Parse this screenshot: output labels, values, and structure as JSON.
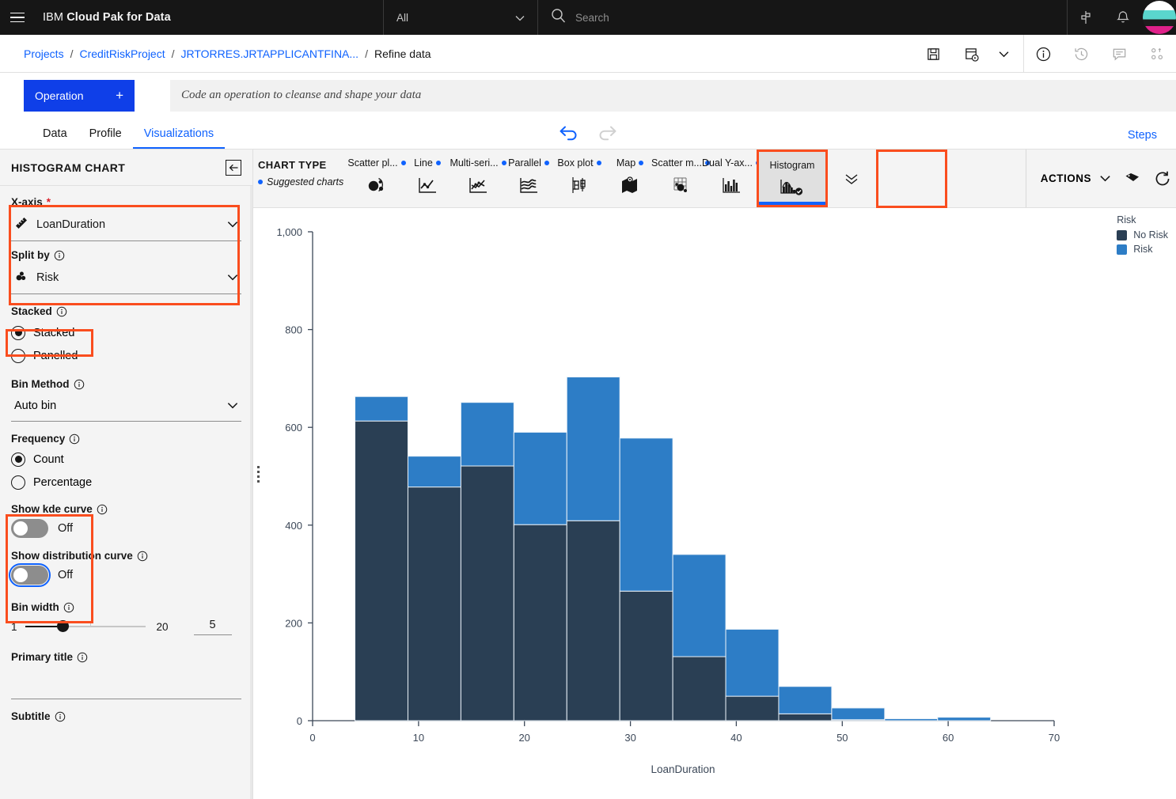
{
  "topbar": {
    "menu_icon": "hamburger-icon",
    "brand_prefix": "IBM",
    "brand_name": "Cloud Pak for Data",
    "scope_selector": "All",
    "search_placeholder": "Search",
    "icons": [
      "switcher-icon",
      "notification-bell-icon",
      "user-avatar"
    ]
  },
  "breadcrumb": {
    "items": [
      {
        "label": "Projects",
        "link": true
      },
      {
        "label": "CreditRiskProject",
        "link": true
      },
      {
        "label": "JRTORRES.JRTAPPLICANTFINA...",
        "link": true
      },
      {
        "label": "Refine data",
        "link": false
      }
    ],
    "separator": "/",
    "tools": [
      "save-icon",
      "run-icon",
      "chevron-down-icon",
      "information-icon",
      "history-icon",
      "comment-icon",
      "shortcuts-icon"
    ]
  },
  "operation": {
    "button_label": "Operation",
    "button_plus": "+",
    "code_placeholder": "Code an operation to cleanse and shape your data"
  },
  "tabs": {
    "items": [
      "Data",
      "Profile",
      "Visualizations"
    ],
    "active": "Visualizations",
    "undo_icon": "undo-icon",
    "redo_icon": "redo-icon",
    "steps_label": "Steps"
  },
  "panel": {
    "title": "HISTOGRAM CHART",
    "collapse_icon": "collapse-panel-icon",
    "x_axis": {
      "label": "X-axis",
      "required_mark": "*",
      "value": "LoanDuration",
      "icon": "measure-icon"
    },
    "split_by": {
      "label": "Split by",
      "value": "Risk",
      "icon": "category-icon"
    },
    "stacked": {
      "label": "Stacked",
      "options": [
        "Stacked",
        "Panelled"
      ],
      "selected": "Stacked"
    },
    "bin_method": {
      "label": "Bin Method",
      "value": "Auto bin"
    },
    "frequency": {
      "label": "Frequency",
      "options": [
        "Count",
        "Percentage"
      ],
      "selected": "Count"
    },
    "kde": {
      "label": "Show kde curve",
      "state": "Off"
    },
    "distribution": {
      "label": "Show distribution curve",
      "state": "Off"
    },
    "bin_width": {
      "label": "Bin width",
      "min": "1",
      "max": "20",
      "value": "5"
    },
    "primary_title": {
      "label": "Primary title",
      "value": ""
    },
    "subtitle": {
      "label": "Subtitle",
      "value": ""
    }
  },
  "chart_type_bar": {
    "heading": "CHART TYPE",
    "suggested_label": "Suggested charts",
    "items": [
      {
        "label": "Scatter pl...",
        "icon": "scatter-plot-icon",
        "suggested": true,
        "selected": false
      },
      {
        "label": "Line",
        "icon": "line-chart-icon",
        "suggested": true,
        "selected": false
      },
      {
        "label": "Multi-seri...",
        "icon": "multi-series-icon",
        "suggested": true,
        "selected": false
      },
      {
        "label": "Parallel",
        "icon": "parallel-coordinates-icon",
        "suggested": true,
        "selected": false
      },
      {
        "label": "Box plot",
        "icon": "box-plot-icon",
        "suggested": true,
        "selected": false
      },
      {
        "label": "Map",
        "icon": "map-icon",
        "suggested": true,
        "selected": false
      },
      {
        "label": "Scatter m...",
        "icon": "scatter-matrix-icon",
        "suggested": true,
        "selected": false
      },
      {
        "label": "Dual Y-ax...",
        "icon": "dual-y-axes-icon",
        "suggested": true,
        "selected": false
      },
      {
        "label": "Histogram",
        "icon": "histogram-icon",
        "suggested": false,
        "selected": true
      }
    ],
    "expand_icon": "chevron-double-down-icon",
    "actions_label": "ACTIONS",
    "actions_chevron": "chevron-down-icon",
    "tag_icon": "tag-icon",
    "reset_icon": "reset-icon"
  },
  "chart_data": {
    "type": "bar",
    "title": "",
    "subtitle": "",
    "xlabel": "LoanDuration",
    "ylabel": "",
    "xlim": [
      0,
      70
    ],
    "ylim": [
      0,
      1000
    ],
    "xticks": [
      "0",
      "10",
      "20",
      "30",
      "40",
      "50",
      "60",
      "70"
    ],
    "yticks": [
      "0",
      "200",
      "400",
      "600",
      "800",
      "1,000"
    ],
    "grid": false,
    "stacked": true,
    "bin_width": 5,
    "legend": {
      "title": "Risk",
      "position": "right",
      "entries": [
        {
          "name": "No Risk",
          "color": "#2a3f54"
        },
        {
          "name": "Risk",
          "color": "#2d7dc6"
        }
      ]
    },
    "bins": [
      {
        "x0": 4,
        "x1": 9,
        "no_risk": 613,
        "risk": 50,
        "total": 663
      },
      {
        "x0": 9,
        "x1": 14,
        "no_risk": 478,
        "risk": 63,
        "total": 541
      },
      {
        "x0": 14,
        "x1": 19,
        "no_risk": 521,
        "risk": 130,
        "total": 651
      },
      {
        "x0": 19,
        "x1": 24,
        "no_risk": 401,
        "risk": 189,
        "total": 590
      },
      {
        "x0": 24,
        "x1": 29,
        "no_risk": 409,
        "risk": 294,
        "total": 703
      },
      {
        "x0": 29,
        "x1": 34,
        "no_risk": 265,
        "risk": 313,
        "total": 578
      },
      {
        "x0": 34,
        "x1": 39,
        "no_risk": 131,
        "risk": 209,
        "total": 340
      },
      {
        "x0": 39,
        "x1": 44,
        "no_risk": 50,
        "risk": 137,
        "total": 187
      },
      {
        "x0": 44,
        "x1": 49,
        "no_risk": 14,
        "risk": 56,
        "total": 70
      },
      {
        "x0": 49,
        "x1": 54,
        "no_risk": 2,
        "risk": 24,
        "total": 26
      },
      {
        "x0": 54,
        "x1": 59,
        "no_risk": 0,
        "risk": 4,
        "total": 4
      },
      {
        "x0": 59,
        "x1": 64,
        "no_risk": 0,
        "risk": 7,
        "total": 7
      }
    ]
  },
  "colors": {
    "brand_blue": "#0f62fe",
    "operation_blue": "#0f3fe8",
    "annotation_red": "#fa4d1e",
    "series_no_risk": "#2a3f54",
    "series_risk": "#2d7dc6"
  }
}
